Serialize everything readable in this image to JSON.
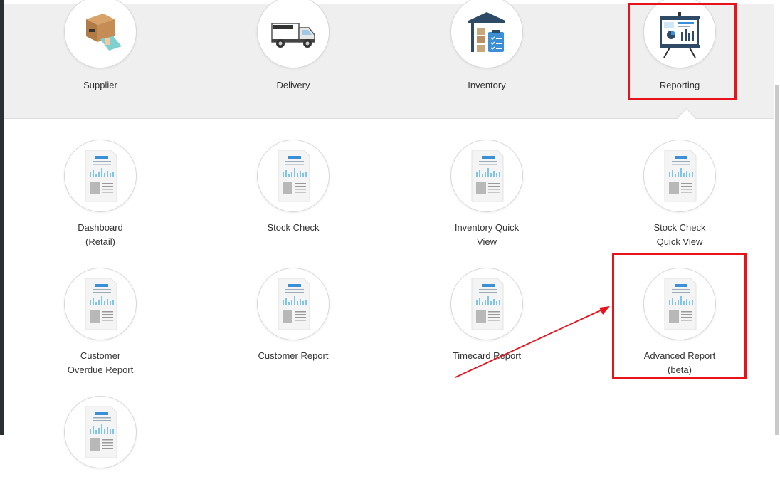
{
  "nav": {
    "items": [
      {
        "label": "Supplier",
        "icon": "supplier-box-icon"
      },
      {
        "label": "Delivery",
        "icon": "delivery-truck-icon"
      },
      {
        "label": "Inventory",
        "icon": "inventory-warehouse-icon"
      },
      {
        "label": "Reporting",
        "icon": "reporting-board-icon"
      }
    ]
  },
  "reports": {
    "items": [
      {
        "label": "Dashboard\n(Retail)"
      },
      {
        "label": "Stock Check"
      },
      {
        "label": "Inventory Quick\nView"
      },
      {
        "label": "Stock Check\nQuick View"
      },
      {
        "label": "Customer\nOverdue Report"
      },
      {
        "label": "Customer Report"
      },
      {
        "label": "Timecard Report"
      },
      {
        "label": "Advanced Report\n(beta)"
      },
      {
        "label": ""
      }
    ]
  },
  "colors": {
    "highlight": "#e8121b",
    "accent": "#3a8fd6",
    "nav_bg": "#efefef"
  }
}
